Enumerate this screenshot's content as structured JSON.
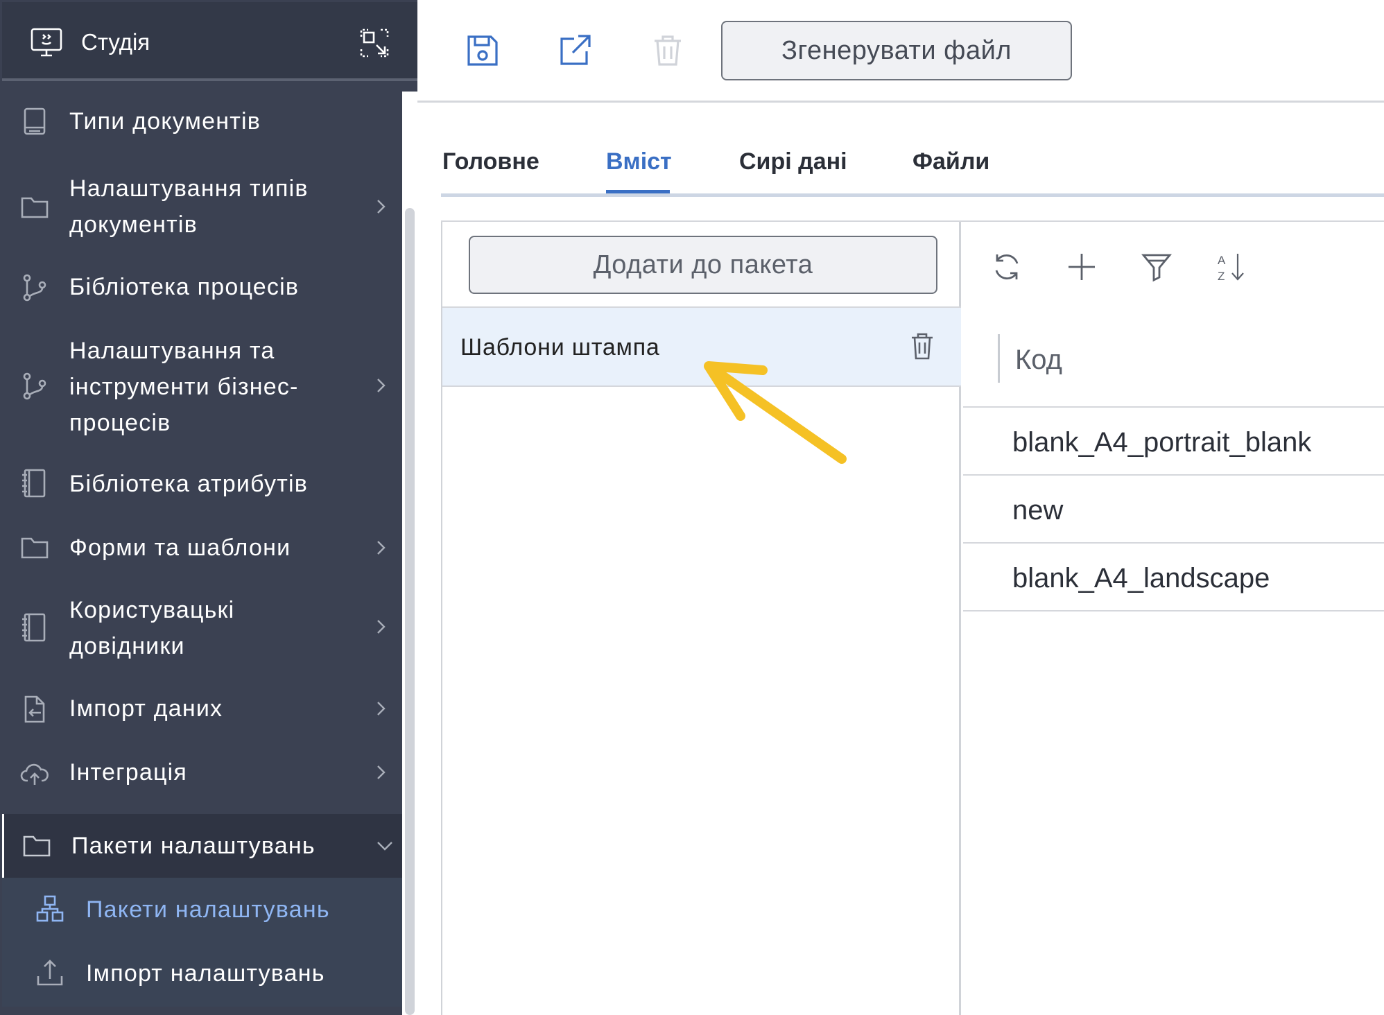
{
  "sidebar": {
    "title": "Студія",
    "items": [
      {
        "label": "Типи документів",
        "icon": "document-icon"
      },
      {
        "label": "Налаштування типів документів",
        "icon": "folder-icon"
      },
      {
        "label": "Бібліотека процесів",
        "icon": "branch-icon"
      },
      {
        "label": "Налаштування та інструменти бізнес-процесів",
        "icon": "branch-icon"
      },
      {
        "label": "Бібліотека атрибутів",
        "icon": "notebook-icon"
      },
      {
        "label": "Форми та шаблони",
        "icon": "folder-icon"
      },
      {
        "label": "Користувацькі довідники",
        "icon": "notebook-icon"
      },
      {
        "label": "Імпорт даних",
        "icon": "file-import-icon"
      },
      {
        "label": "Інтеграція",
        "icon": "cloud-upload-icon"
      },
      {
        "label": "Пакети налаштувань",
        "icon": "folder-icon"
      }
    ],
    "subitems": [
      {
        "label": "Пакети налаштувань",
        "icon": "packages-icon"
      },
      {
        "label": "Імпорт налаштувань",
        "icon": "upload-icon"
      }
    ]
  },
  "toolbar": {
    "generate_label": "Згенерувати файл"
  },
  "tabs": [
    "Головне",
    "Вміст",
    "Сирі дані",
    "Файли"
  ],
  "active_tab": "Вміст",
  "left_panel": {
    "add_label": "Додати до пакета",
    "items": [
      "Шаблони штампа"
    ]
  },
  "right_panel": {
    "column": "Код",
    "rows": [
      "blank_A4_portrait_blank",
      "new",
      "blank_A4_landscape"
    ]
  },
  "colors": {
    "sidebar_bg": "#3b4152",
    "accent": "#3a6fc4",
    "selected_row": "#e9f1fb",
    "arrow": "#f5c125"
  }
}
